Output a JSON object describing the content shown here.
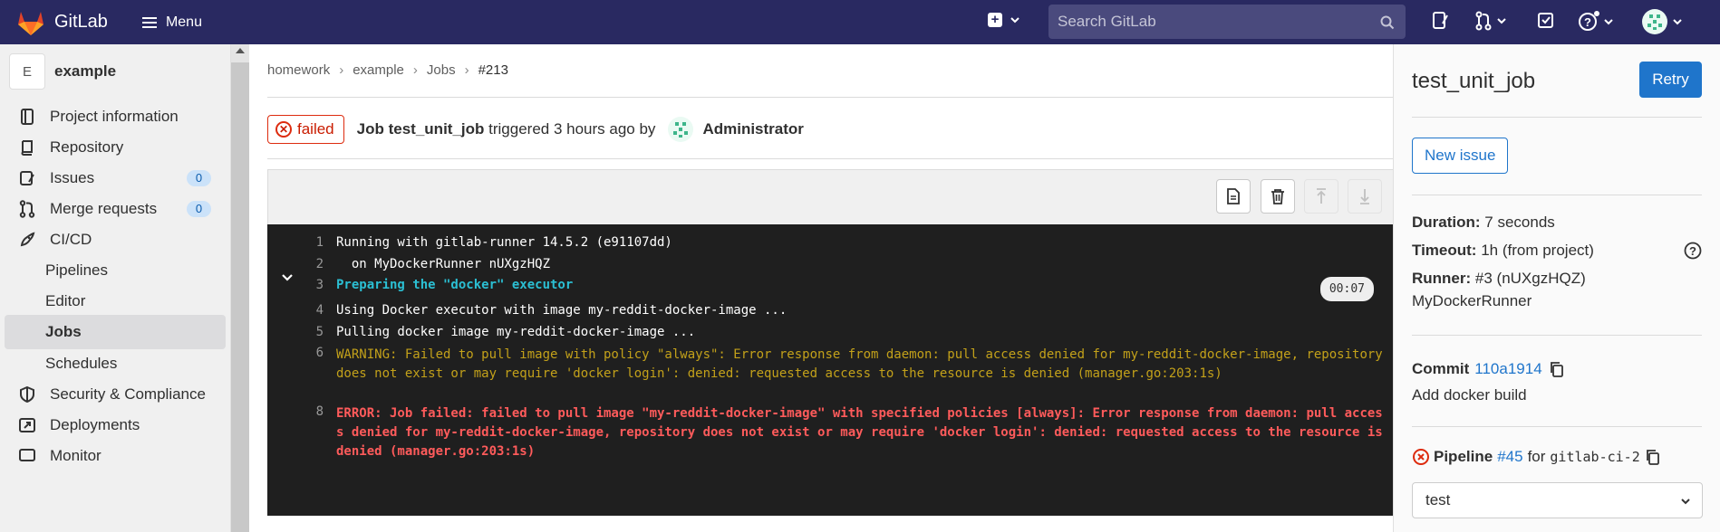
{
  "navbar": {
    "logo_text": "GitLab",
    "menu_label": "Menu",
    "search_placeholder": "Search GitLab"
  },
  "sidebar": {
    "project_initial": "E",
    "project_name": "example",
    "items": [
      {
        "label": "Project information",
        "icon": "info-doc-icon"
      },
      {
        "label": "Repository",
        "icon": "repository-icon"
      },
      {
        "label": "Issues",
        "icon": "issues-icon",
        "count": "0"
      },
      {
        "label": "Merge requests",
        "icon": "merge-request-icon",
        "count": "0"
      },
      {
        "label": "CI/CD",
        "icon": "rocket-icon"
      },
      {
        "label": "Pipelines"
      },
      {
        "label": "Editor"
      },
      {
        "label": "Jobs"
      },
      {
        "label": "Schedules"
      },
      {
        "label": "Security & Compliance",
        "icon": "shield-icon"
      },
      {
        "label": "Deployments",
        "icon": "deployments-icon"
      },
      {
        "label": "Monitor",
        "icon": "monitor-icon"
      }
    ]
  },
  "breadcrumb": [
    "homework",
    "example",
    "Jobs",
    "#213"
  ],
  "job_header": {
    "status": "failed",
    "job_prefix": "Job",
    "job_name": "test_unit_job",
    "triggered_text": "triggered 3 hours ago by",
    "user": "Administrator"
  },
  "trace": {
    "duration": "00:07",
    "lines": [
      {
        "num": "1",
        "text": "Running with gitlab-runner 14.5.2 (e91107dd)",
        "style": "normal"
      },
      {
        "num": "2",
        "text": "  on MyDockerRunner nUXgzHQZ",
        "style": "normal"
      },
      {
        "num": "3",
        "text": "Preparing the \"docker\" executor",
        "style": "cyan"
      },
      {
        "num": "4",
        "text": "Using Docker executor with image my-reddit-docker-image ...",
        "style": "normal"
      },
      {
        "num": "5",
        "text": "Pulling docker image my-reddit-docker-image ...",
        "style": "normal"
      },
      {
        "num": "6",
        "text": "WARNING: Failed to pull image with policy \"always\": Error response from daemon: pull access denied for my-reddit-docker-image, repository does not exist or may require 'docker login': denied: requested access to the resource is denied (manager.go:203:1s)",
        "style": "yellow"
      },
      {
        "num": "8",
        "text": "ERROR: Job failed: failed to pull image \"my-reddit-docker-image\" with specified policies [always]: Error response from daemon: pull access denied for my-reddit-docker-image, repository does not exist or may require 'docker login': denied: requested access to the resource is denied (manager.go:203:1s)",
        "style": "red"
      }
    ]
  },
  "right_sidebar": {
    "title": "test_unit_job",
    "retry_label": "Retry",
    "new_issue_label": "New issue",
    "duration_label": "Duration:",
    "duration_value": "7 seconds",
    "timeout_label": "Timeout:",
    "timeout_value": "1h (from project)",
    "runner_label": "Runner:",
    "runner_value": "#3 (nUXgzHQZ)",
    "runner_name": "MyDockerRunner",
    "commit_label": "Commit",
    "commit_sha": "110a1914",
    "commit_message": "Add docker build",
    "pipeline_label": "Pipeline",
    "pipeline_id": "#45",
    "pipeline_for": "for",
    "pipeline_ref": "gitlab-ci-2",
    "stage_selected": "test"
  },
  "colors": {
    "navbar": "#292961",
    "accent": "#1f75cb",
    "failed": "#dd2b0e"
  }
}
